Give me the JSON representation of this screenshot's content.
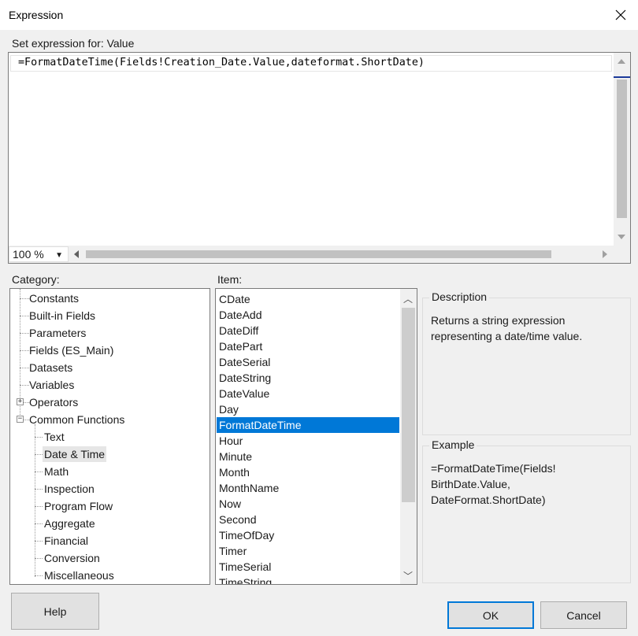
{
  "window": {
    "title": "Expression"
  },
  "expression": {
    "label": "Set expression for: Value",
    "value": "=FormatDateTime(Fields!Creation_Date.Value,dateformat.ShortDate)",
    "zoom": "100 %"
  },
  "category": {
    "label": "Category:",
    "items": [
      "Constants",
      "Built-in Fields",
      "Parameters",
      "Fields (ES_Main)",
      "Datasets",
      "Variables",
      "Operators",
      "Common Functions"
    ],
    "sub_items": [
      "Text",
      "Date & Time",
      "Math",
      "Inspection",
      "Program Flow",
      "Aggregate",
      "Financial",
      "Conversion",
      "Miscellaneous"
    ],
    "selected": "Date & Time"
  },
  "item": {
    "label": "Item:",
    "items": [
      "CDate",
      "DateAdd",
      "DateDiff",
      "DatePart",
      "DateSerial",
      "DateString",
      "DateValue",
      "Day",
      "FormatDateTime",
      "Hour",
      "Minute",
      "Month",
      "MonthName",
      "Now",
      "Second",
      "TimeOfDay",
      "Timer",
      "TimeSerial",
      "TimeString"
    ],
    "selected": "FormatDateTime"
  },
  "description": {
    "title": "Description",
    "line1": "Returns a string expression",
    "line2": "representing a date/time value."
  },
  "example": {
    "title": "Example",
    "line1": "=FormatDateTime(Fields!",
    "line2": "BirthDate.Value,",
    "line3": "DateFormat.ShortDate)"
  },
  "buttons": {
    "help": "Help",
    "ok": "OK",
    "cancel": "Cancel"
  },
  "icons": {
    "close": "close-icon",
    "expand": "plus-expander-icon",
    "collapse": "minus-expander-icon",
    "scroll_up": "chevron-up-icon",
    "scroll_down": "chevron-down-icon"
  },
  "colors": {
    "selection": "#0078d7",
    "default_button_border": "#0078d7"
  }
}
